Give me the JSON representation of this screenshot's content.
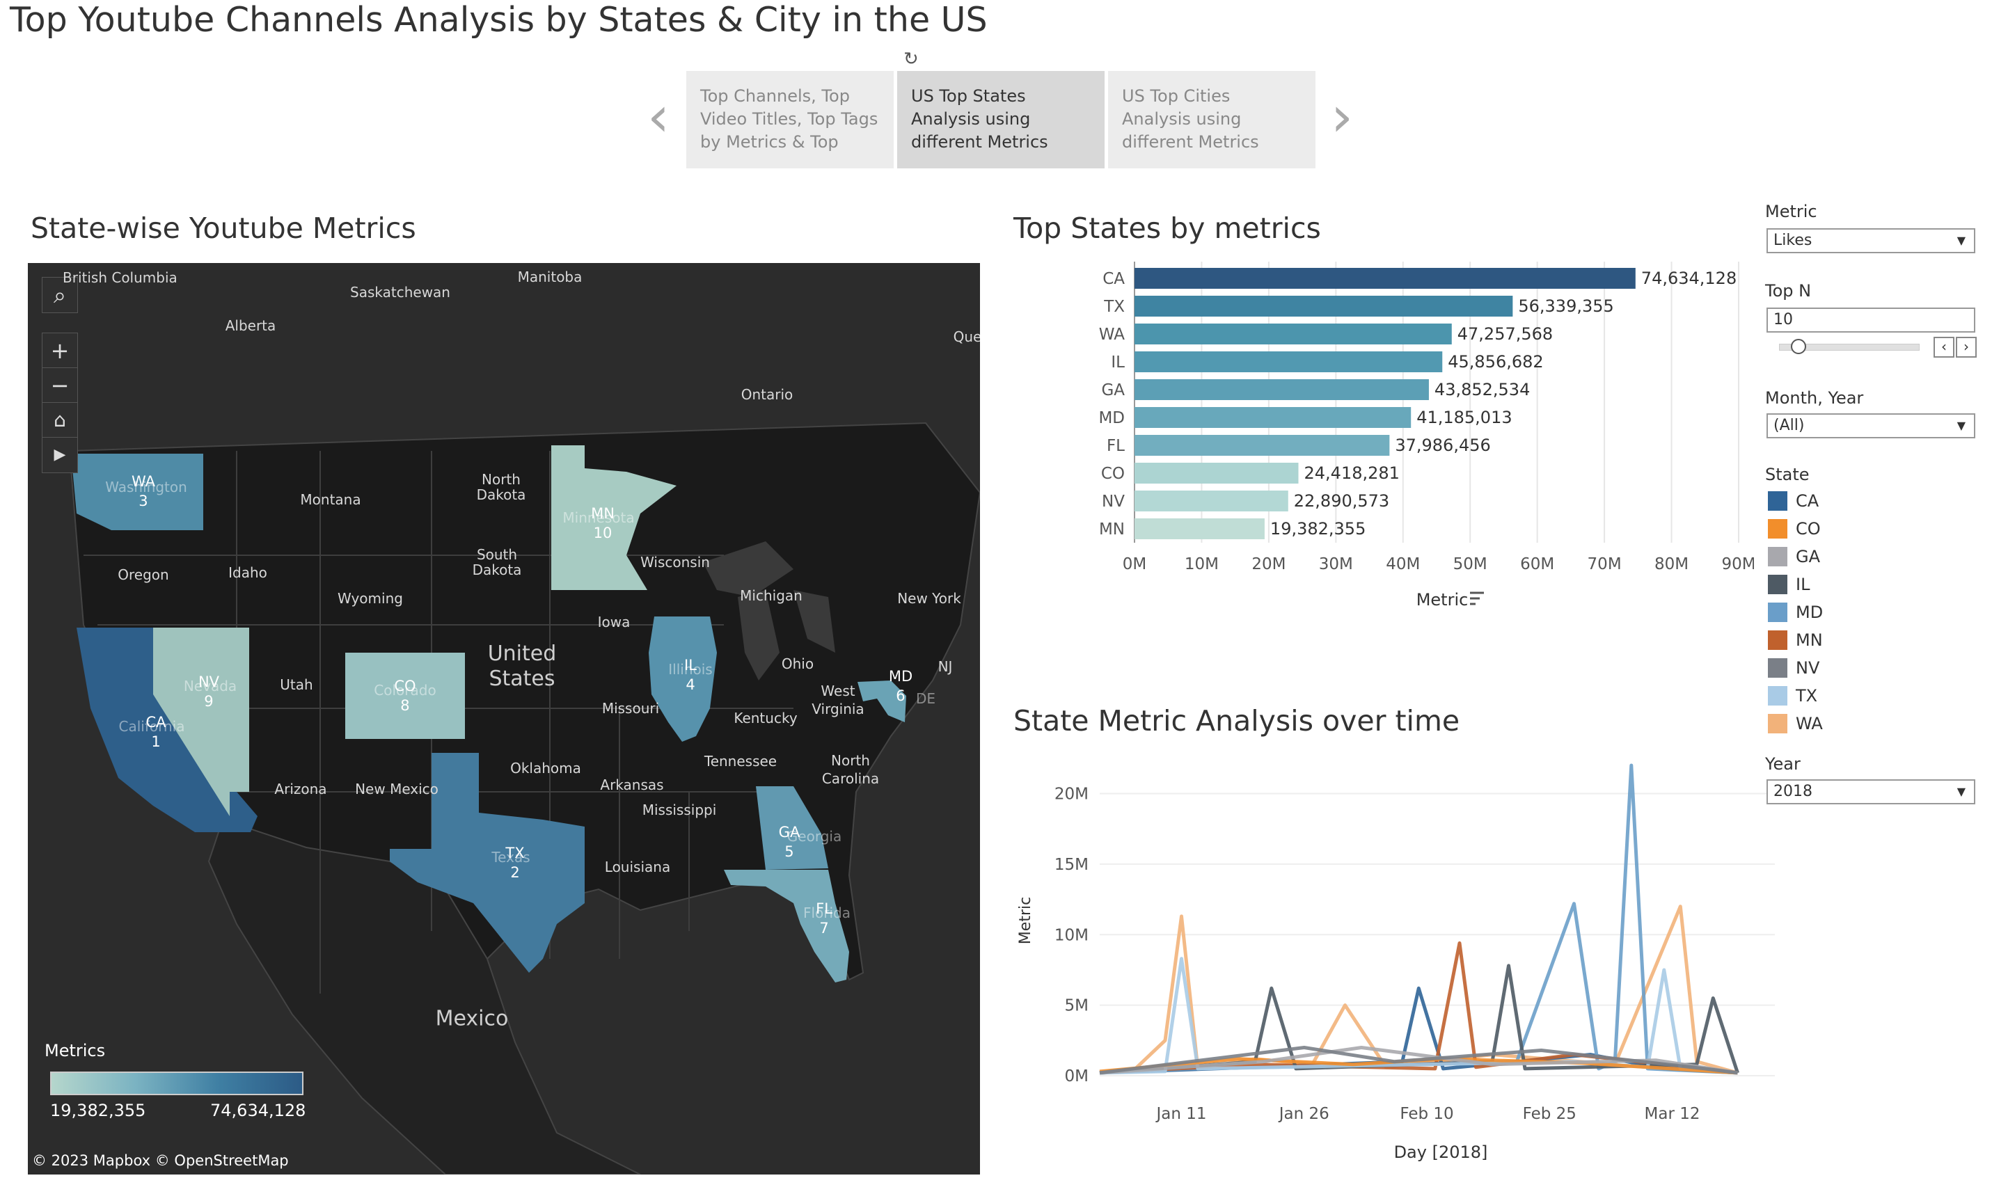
{
  "page": {
    "title": "Top Youtube Channels Analysis by States & City in the US"
  },
  "nav": {
    "tabs": [
      {
        "label": "Top Channels, Top Video Titles, Top Tags by Metrics & Top"
      },
      {
        "label": "US Top States Analysis using different Metrics"
      },
      {
        "label": "US Top Cities Analysis using different Metrics"
      }
    ],
    "active_tab_index": 1
  },
  "map": {
    "title": "State-wise Youtube Metrics",
    "legend_title": "Metrics",
    "legend_min": "19,382,355",
    "legend_max": "74,634,128",
    "attribution": "© 2023 Mapbox  © OpenStreetMap",
    "place_labels": [
      "British Columbia",
      "Manitoba",
      "Saskatchewan",
      "Alberta",
      "Que",
      "Ontario",
      "Montana",
      "North Dakota",
      "Wisconsin",
      "Oregon",
      "Idaho",
      "South Dakota",
      "Michigan",
      "New York",
      "Wyoming",
      "Iowa",
      "Utah",
      "Ohio",
      "NJ",
      "West Virginia",
      "Missouri",
      "Kentucky",
      "Oklahoma",
      "Tennessee",
      "North Carolina",
      "Arizona",
      "New Mexico",
      "Arkansas",
      "Mississippi",
      "Louisiana",
      "Mexico"
    ],
    "country_label": "United States",
    "states": [
      {
        "code": "CA",
        "rank": "1",
        "color": "#2e5f8a"
      },
      {
        "code": "TX",
        "rank": "2",
        "color": "#437a9d"
      },
      {
        "code": "WA",
        "rank": "3",
        "color": "#4f8ba6"
      },
      {
        "code": "IL",
        "rank": "4",
        "color": "#5792ac"
      },
      {
        "code": "GA",
        "rank": "5",
        "color": "#6199b0"
      },
      {
        "code": "MD",
        "rank": "6",
        "color": "#6aa3b5"
      },
      {
        "code": "FL",
        "rank": "7",
        "color": "#75aab9"
      },
      {
        "code": "CO",
        "rank": "8",
        "color": "#98c1c1"
      },
      {
        "code": "NV",
        "rank": "9",
        "color": "#9fc3bd"
      },
      {
        "code": "MN",
        "rank": "10",
        "color": "#a7cbc2"
      }
    ],
    "ghost_names": [
      "Washington",
      "Minnesota",
      "Nevada",
      "Colorado",
      "Illinois",
      "California",
      "Texas",
      "Georgia",
      "Florida",
      "DE"
    ]
  },
  "bar_chart": {
    "title": "Top States by metrics",
    "axis_title": "Metric",
    "tick_labels": [
      "0M",
      "10M",
      "20M",
      "30M",
      "40M",
      "50M",
      "60M",
      "70M",
      "80M",
      "90M"
    ],
    "value_labels": [
      "74,634,128",
      "56,339,355",
      "47,257,568",
      "45,856,682",
      "43,852,534",
      "41,185,013",
      "37,986,456",
      "24,418,281",
      "22,890,573",
      "19,382,355"
    ],
    "colors": [
      "#2e5781",
      "#3f84a2",
      "#4c95ad",
      "#5299b1",
      "#5c9fb5",
      "#68a8bb",
      "#72aebf",
      "#acd4d2",
      "#b3d8d5",
      "#c0ddd6"
    ]
  },
  "line_chart": {
    "title": "State Metric Analysis over time",
    "y_axis_title": "Metric",
    "x_axis_title": "Day [2018]",
    "y_tick_labels": [
      "0M",
      "5M",
      "10M",
      "15M",
      "20M"
    ],
    "x_tick_labels": [
      "Jan 11",
      "Jan 26",
      "Feb 10",
      "Feb 25",
      "Mar 12"
    ]
  },
  "controls": {
    "metric_label": "Metric",
    "metric_value": "Likes",
    "topn_label": "Top N",
    "topn_value": "10",
    "topn_slider_fraction": 0.13,
    "month_year_label": "Month, Year",
    "month_year_value": "(All)",
    "state_legend_title": "State",
    "state_legend": [
      {
        "code": "CA",
        "color": "#2f6497"
      },
      {
        "code": "CO",
        "color": "#f28e2b"
      },
      {
        "code": "GA",
        "color": "#a8a8ad"
      },
      {
        "code": "IL",
        "color": "#4e5a64"
      },
      {
        "code": "MD",
        "color": "#6a9ec9"
      },
      {
        "code": "MN",
        "color": "#c0612d"
      },
      {
        "code": "NV",
        "color": "#7a7f87"
      },
      {
        "code": "TX",
        "color": "#a9cbe6"
      },
      {
        "code": "WA",
        "color": "#f2b27a"
      }
    ],
    "year_label": "Year",
    "year_value": "2018"
  },
  "chart_data": [
    {
      "type": "bar",
      "title": "Top States by metrics",
      "categories": [
        "CA",
        "TX",
        "WA",
        "IL",
        "GA",
        "MD",
        "FL",
        "CO",
        "NV",
        "MN"
      ],
      "values": [
        74634128,
        56339355,
        47257568,
        45856682,
        43852534,
        41185013,
        37986456,
        24418281,
        22890573,
        19382355
      ],
      "xlabel": "Metric",
      "xlim": [
        0,
        90000000
      ],
      "orientation": "horizontal",
      "grid": true
    },
    {
      "type": "line",
      "title": "State Metric Analysis over time",
      "xlabel": "Day [2018]",
      "ylabel": "Metric",
      "ylim": [
        0,
        22000000
      ],
      "xlim": [
        "2018-01-01",
        "2018-03-22"
      ],
      "series": [
        {
          "name": "WA",
          "x": [
            "2018-01-01",
            "2018-01-05",
            "2018-01-09",
            "2018-01-11",
            "2018-01-13",
            "2018-01-20",
            "2018-01-27",
            "2018-01-31",
            "2018-02-05",
            "2018-02-18",
            "2018-03-05",
            "2018-03-13",
            "2018-03-15",
            "2018-03-20"
          ],
          "values": [
            0.2,
            0.3,
            2.5,
            11.3,
            0.5,
            1.2,
            0.8,
            5.0,
            0.6,
            1.5,
            0.8,
            12.0,
            1.0,
            0.2
          ]
        },
        {
          "name": "CA",
          "x": [
            "2018-01-01",
            "2018-01-15",
            "2018-01-29",
            "2018-02-07",
            "2018-02-09",
            "2018-02-12",
            "2018-02-21",
            "2018-03-02",
            "2018-03-11",
            "2018-03-20"
          ],
          "values": [
            0.2,
            0.5,
            0.8,
            1.0,
            6.2,
            0.5,
            1.0,
            1.5,
            0.5,
            0.2
          ]
        },
        {
          "name": "MD",
          "x": [
            "2018-01-01",
            "2018-01-12",
            "2018-02-10",
            "2018-02-21",
            "2018-02-28",
            "2018-03-03",
            "2018-03-05",
            "2018-03-07",
            "2018-03-09",
            "2018-03-20"
          ],
          "values": [
            0.2,
            0.5,
            0.8,
            1.0,
            12.2,
            0.5,
            1.0,
            22.0,
            0.5,
            0.2
          ]
        },
        {
          "name": "MN",
          "x": [
            "2018-01-01",
            "2018-01-20",
            "2018-02-11",
            "2018-02-14",
            "2018-02-16",
            "2018-02-28",
            "2018-03-20"
          ],
          "values": [
            0.2,
            0.8,
            0.5,
            9.4,
            0.6,
            1.5,
            0.2
          ]
        },
        {
          "name": "IL",
          "x": [
            "2018-01-01",
            "2018-01-20",
            "2018-01-22",
            "2018-01-25",
            "2018-02-18",
            "2018-02-20",
            "2018-02-22",
            "2018-03-15",
            "2018-03-17",
            "2018-03-20"
          ],
          "values": [
            0.2,
            1.0,
            6.2,
            0.5,
            1.0,
            7.8,
            0.5,
            0.8,
            5.5,
            0.2
          ]
        },
        {
          "name": "TX",
          "x": [
            "2018-01-01",
            "2018-01-09",
            "2018-01-11",
            "2018-01-13",
            "2018-02-28",
            "2018-03-09",
            "2018-03-11",
            "2018-03-13",
            "2018-03-20"
          ],
          "values": [
            0.2,
            0.3,
            8.3,
            0.5,
            1.0,
            0.6,
            7.5,
            0.5,
            0.2
          ]
        },
        {
          "name": "CO",
          "x": [
            "2018-01-01",
            "2018-01-18",
            "2018-02-01",
            "2018-02-12",
            "2018-03-01",
            "2018-03-20"
          ],
          "values": [
            0.3,
            1.2,
            0.8,
            1.2,
            0.9,
            0.2
          ]
        },
        {
          "name": "GA",
          "x": [
            "2018-01-01",
            "2018-01-21",
            "2018-02-02",
            "2018-02-18",
            "2018-03-10",
            "2018-03-20"
          ],
          "values": [
            0.2,
            1.0,
            2.0,
            0.8,
            1.1,
            0.2
          ]
        },
        {
          "name": "NV",
          "x": [
            "2018-01-01",
            "2018-01-26",
            "2018-02-06",
            "2018-02-24",
            "2018-03-16",
            "2018-03-20"
          ],
          "values": [
            0.2,
            2.0,
            1.0,
            1.8,
            0.5,
            0.2
          ]
        }
      ]
    }
  ]
}
